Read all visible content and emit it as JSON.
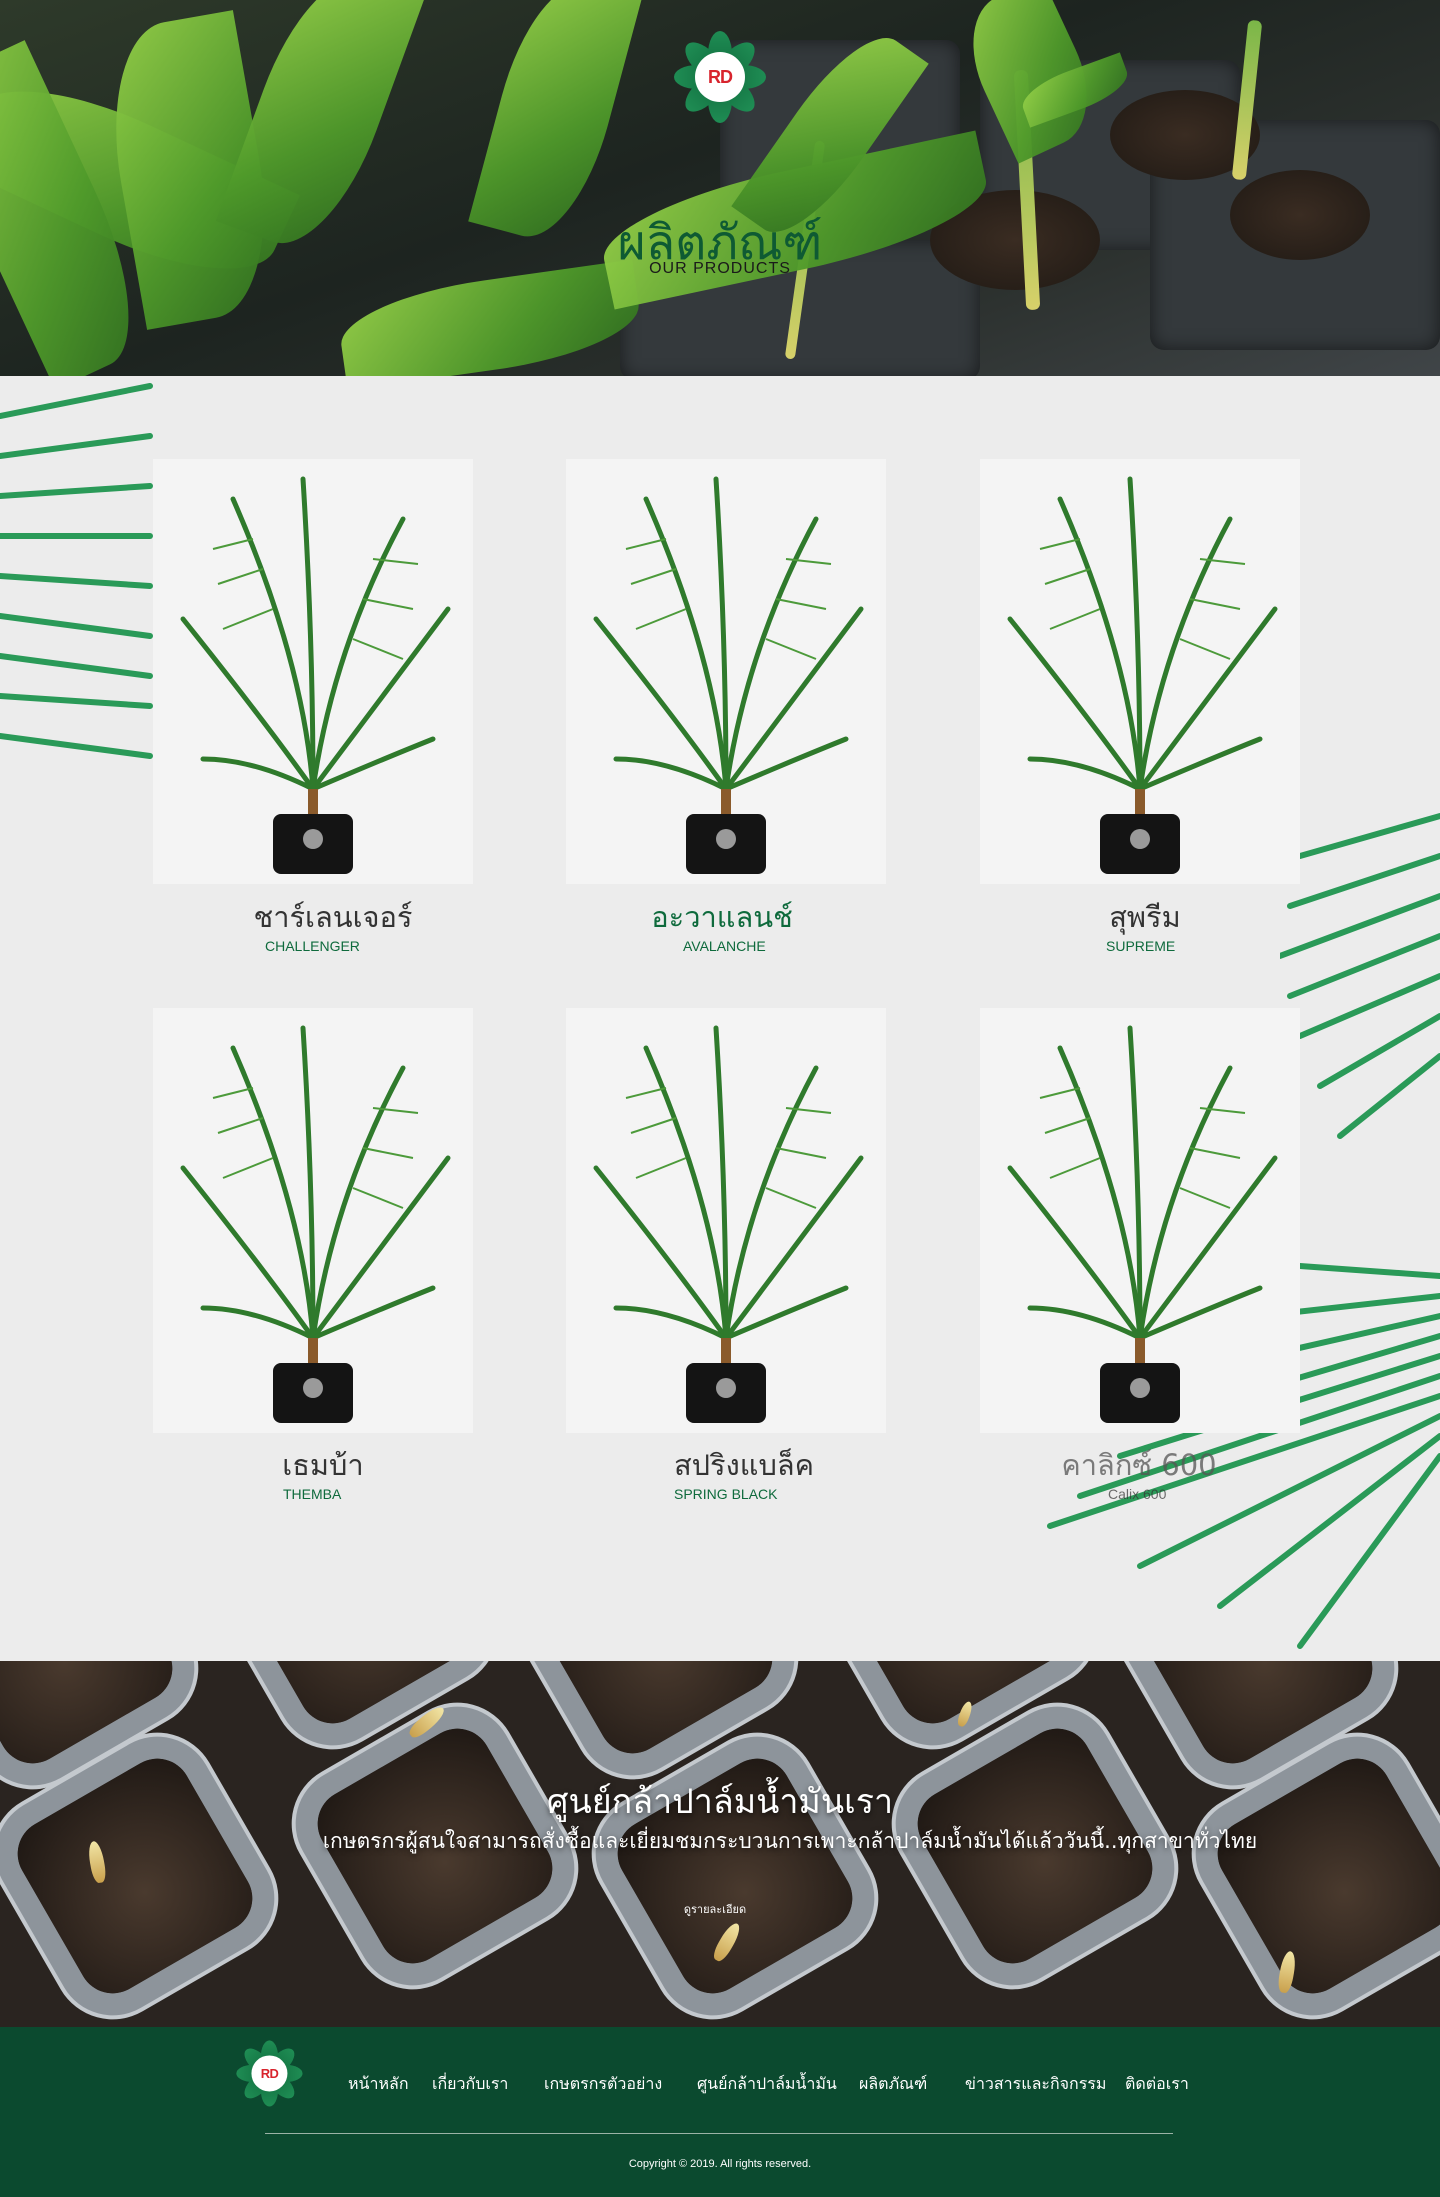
{
  "hero": {
    "logo_text": "RD",
    "title": "ผลิตภัณฑ์",
    "subtitle": "OUR PRODUCTS"
  },
  "products": [
    {
      "name": "ชาร์เลนเจอร์",
      "name_en": "CHALLENGER"
    },
    {
      "name": "อะวาแลนช์",
      "name_en": "AVALANCHE"
    },
    {
      "name": "สุพรีม",
      "name_en": "SUPREME"
    },
    {
      "name": "เธมบ้า",
      "name_en": "THEMBA"
    },
    {
      "name": "สปริงแบล็ค",
      "name_en": "SPRING BLACK"
    },
    {
      "name": "คาลิกซ์ 600",
      "name_en": "Calix 600"
    }
  ],
  "banner": {
    "title": "ศูนย์กล้าปาล์มน้ำมันเรา",
    "description": "เกษตรกรผู้สนใจสามารถสั่งซื้อและเยี่ยมชมกระบวนการเพาะกล้าปาล์มน้ำมันได้แล้ววันนี้..ทุกสาขาทั่วไทย",
    "link_label": "ดูรายละเอียด"
  },
  "footer": {
    "logo_text": "RD",
    "nav": [
      "หน้าหลัก",
      "เกี่ยวกับเรา",
      "เกษตรกรตัวอย่าง",
      "ศูนย์กล้าปาล์มน้ำมัน",
      "ผลิตภัณฑ์",
      "ข่าวสารและกิจกรรม",
      "ติดต่อเรา"
    ],
    "copyright": "Copyright © 2019. All rights reserved."
  },
  "colors": {
    "brand_green": "#0b4a2f",
    "title_green": "#0e5a33",
    "logo_red": "#d8242d",
    "section_bg": "#ececec"
  }
}
